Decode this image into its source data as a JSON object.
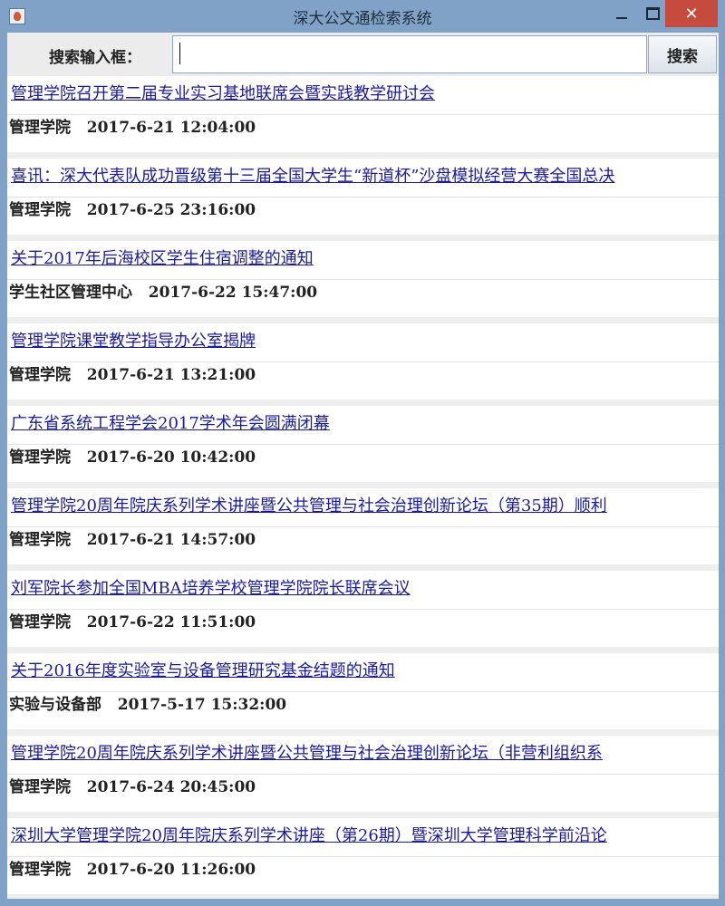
{
  "window": {
    "title": "深大公文通检索系统",
    "close_glyph": "✕"
  },
  "search": {
    "label": "搜索输入框：",
    "value": "",
    "placeholder": "",
    "button_label": "搜索"
  },
  "results": [
    {
      "title": "管理学院召开第二届专业实习基地联席会暨实践教学研讨会",
      "dept": "管理学院",
      "datetime": "2017-6-21 12:04:00"
    },
    {
      "title": "喜讯：深大代表队成功晋级第十三届全国大学生“新道杯”沙盘模拟经营大赛全国总决",
      "dept": "管理学院",
      "datetime": "2017-6-25 23:16:00"
    },
    {
      "title": "关于2017年后海校区学生住宿调整的通知",
      "dept": "学生社区管理中心",
      "datetime": "2017-6-22 15:47:00"
    },
    {
      "title": "管理学院课堂教学指导办公室揭牌",
      "dept": "管理学院",
      "datetime": "2017-6-21 13:21:00"
    },
    {
      "title": "广东省系统工程学会2017学术年会圆满闭幕",
      "dept": "管理学院",
      "datetime": "2017-6-20 10:42:00"
    },
    {
      "title": "管理学院20周年院庆系列学术讲座暨公共管理与社会治理创新论坛（第35期）顺利",
      "dept": "管理学院",
      "datetime": "2017-6-21 14:57:00"
    },
    {
      "title": "刘军院长参加全国MBA培养学校管理学院院长联席会议",
      "dept": "管理学院",
      "datetime": "2017-6-22 11:51:00"
    },
    {
      "title": "关于2016年度实验室与设备管理研究基金结题的通知",
      "dept": "实验与设备部",
      "datetime": "2017-5-17 15:32:00"
    },
    {
      "title": "管理学院20周年院庆系列学术讲座暨公共管理与社会治理创新论坛（非营利组织系",
      "dept": "管理学院",
      "datetime": "2017-6-24 20:45:00"
    },
    {
      "title": "深圳大学管理学院20周年院庆系列学术讲座（第26期）暨深圳大学管理科学前沿论",
      "dept": "管理学院",
      "datetime": "2017-6-20 11:26:00"
    }
  ]
}
